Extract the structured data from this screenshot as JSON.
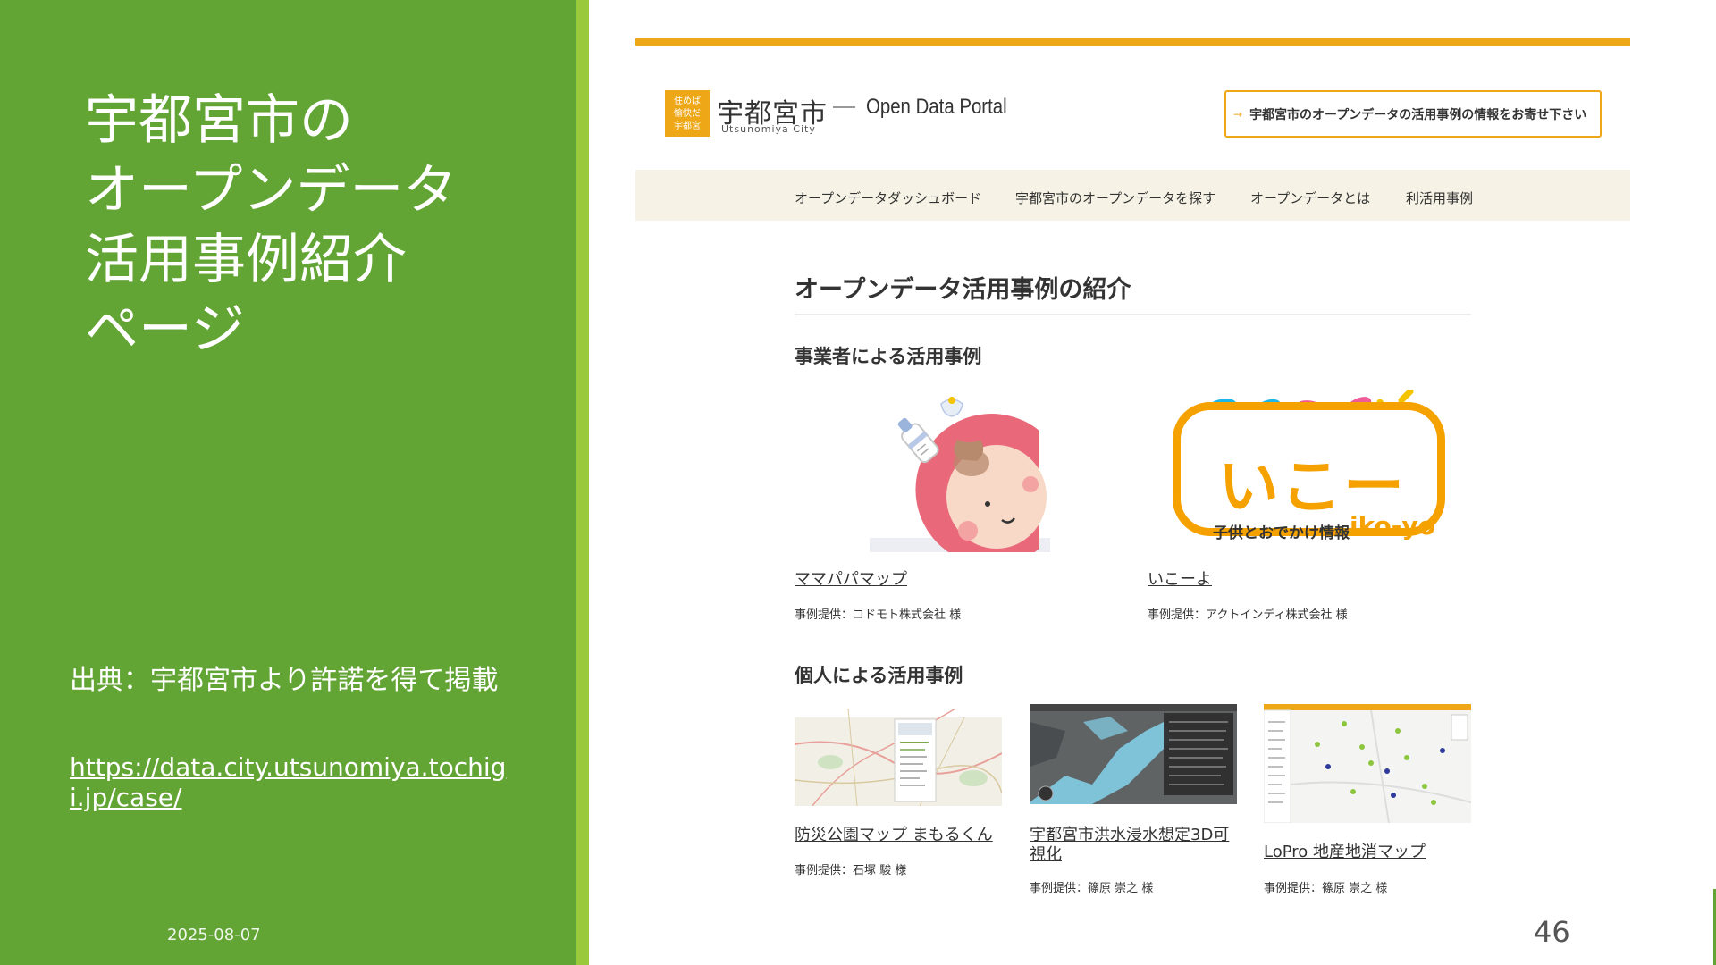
{
  "slide": {
    "title_lines": [
      "宇都宮市の",
      "オープンデータ",
      "活用事例紹介",
      "ページ"
    ],
    "source": "出典：宇都宮市より許諾を得て掲載",
    "url": "https://data.city.utsunomiya.tochigi.jp/case/",
    "date": "2025-08-07",
    "page_number": "46"
  },
  "site": {
    "logo_text": "住めば愉快だ宇都宮",
    "city_name": "宇都宮市",
    "city_romaji": "Utsunomiya City",
    "portal_name": "Open Data Portal",
    "cta_label": "宇都宮市のオープンデータの活用事例の情報をお寄せ下さい",
    "nav": [
      "オープンデータダッシュボード",
      "宇都宮市のオープンデータを探す",
      "オープンデータとは",
      "利活用事例"
    ],
    "page_heading": "オープンデータ活用事例の紹介",
    "business_heading": "事業者による活用事例",
    "business_cases": [
      {
        "title": "ママパパマップ",
        "credit": "事例提供：コドモト株式会社 様"
      },
      {
        "title": "いこーよ",
        "credit": "事例提供：アクトインディ株式会社 様"
      }
    ],
    "ikoyo_logo": {
      "word": "いこーよ",
      "sub": "子供とおでかけ情報",
      "roman": "iko-yo"
    },
    "personal_heading": "個人による活用事例",
    "personal_cases": [
      {
        "title": "防災公園マップ まもるくん",
        "credit": "事例提供：石塚 駿 様"
      },
      {
        "title": "宇都宮市洪水浸水想定3D可視化",
        "credit": "事例提供：篠原 崇之 様"
      },
      {
        "title": "LoPro 地産地消マップ",
        "credit": "事例提供：篠原 崇之 様"
      }
    ]
  },
  "colors": {
    "green": "#63a535",
    "accent_stripe": "#9bc93c",
    "site_orange": "#eea817"
  }
}
